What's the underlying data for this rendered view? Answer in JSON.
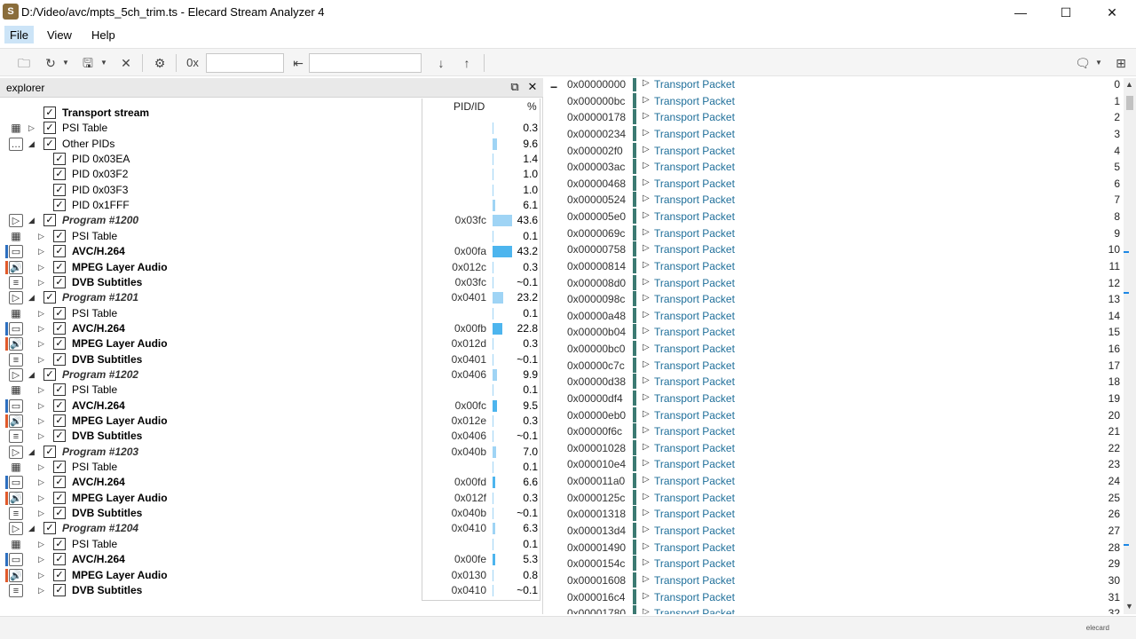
{
  "window": {
    "title": "D:/Video/avc/mpts_5ch_trim.ts - Elecard Stream Analyzer 4",
    "app_icon": "S",
    "minimize": "—",
    "maximize": "☐",
    "close": "✕"
  },
  "menu": {
    "file": "File",
    "view": "View",
    "help": "Help"
  },
  "toolbar": {
    "hex_prefix": "0x",
    "hex_value": "",
    "search_value": ""
  },
  "explorer": {
    "title": "explorer",
    "col_pid": "PID/ID",
    "col_pct": "%",
    "rows": [
      {
        "label": "Transport stream",
        "pid": "",
        "pct": "",
        "style": "bold"
      },
      {
        "label": "PSI Table",
        "pid": "",
        "pct": "0.3",
        "style": "normal"
      },
      {
        "label": "Other PIDs",
        "pid": "",
        "pct": "9.6",
        "style": "normal"
      },
      {
        "label": "PID 0x03EA",
        "pid": "",
        "pct": "1.4",
        "style": "normal"
      },
      {
        "label": "PID 0x03F2",
        "pid": "",
        "pct": "1.0",
        "style": "normal"
      },
      {
        "label": "PID 0x03F3",
        "pid": "",
        "pct": "1.0",
        "style": "normal"
      },
      {
        "label": "PID 0x1FFF",
        "pid": "",
        "pct": "6.1",
        "style": "normal"
      },
      {
        "label": "Program #1200",
        "pid": "0x03fc",
        "pct": "43.6",
        "style": "italic"
      },
      {
        "label": "PSI Table",
        "pid": "",
        "pct": "0.1",
        "style": "normal"
      },
      {
        "label": "AVC/H.264",
        "pid": "0x00fa",
        "pct": "43.2",
        "style": "bold"
      },
      {
        "label": "MPEG Layer Audio",
        "pid": "0x012c",
        "pct": "0.3",
        "style": "bold"
      },
      {
        "label": "DVB Subtitles",
        "pid": "0x03fc",
        "pct": "~0.1",
        "style": "bold"
      },
      {
        "label": "Program #1201",
        "pid": "0x0401",
        "pct": "23.2",
        "style": "italic"
      },
      {
        "label": "PSI Table",
        "pid": "",
        "pct": "0.1",
        "style": "normal"
      },
      {
        "label": "AVC/H.264",
        "pid": "0x00fb",
        "pct": "22.8",
        "style": "bold"
      },
      {
        "label": "MPEG Layer Audio",
        "pid": "0x012d",
        "pct": "0.3",
        "style": "bold"
      },
      {
        "label": "DVB Subtitles",
        "pid": "0x0401",
        "pct": "~0.1",
        "style": "bold"
      },
      {
        "label": "Program #1202",
        "pid": "0x0406",
        "pct": "9.9",
        "style": "italic"
      },
      {
        "label": "PSI Table",
        "pid": "",
        "pct": "0.1",
        "style": "normal"
      },
      {
        "label": "AVC/H.264",
        "pid": "0x00fc",
        "pct": "9.5",
        "style": "bold"
      },
      {
        "label": "MPEG Layer Audio",
        "pid": "0x012e",
        "pct": "0.3",
        "style": "bold"
      },
      {
        "label": "DVB Subtitles",
        "pid": "0x0406",
        "pct": "~0.1",
        "style": "bold"
      },
      {
        "label": "Program #1203",
        "pid": "0x040b",
        "pct": "7.0",
        "style": "italic"
      },
      {
        "label": "PSI Table",
        "pid": "",
        "pct": "0.1",
        "style": "normal"
      },
      {
        "label": "AVC/H.264",
        "pid": "0x00fd",
        "pct": "6.6",
        "style": "bold"
      },
      {
        "label": "MPEG Layer Audio",
        "pid": "0x012f",
        "pct": "0.3",
        "style": "bold"
      },
      {
        "label": "DVB Subtitles",
        "pid": "0x040b",
        "pct": "~0.1",
        "style": "bold"
      },
      {
        "label": "Program #1204",
        "pid": "0x0410",
        "pct": "6.3",
        "style": "italic"
      },
      {
        "label": "PSI Table",
        "pid": "",
        "pct": "0.1",
        "style": "normal"
      },
      {
        "label": "AVC/H.264",
        "pid": "0x00fe",
        "pct": "5.3",
        "style": "bold"
      },
      {
        "label": "MPEG Layer Audio",
        "pid": "0x0130",
        "pct": "0.8",
        "style": "bold"
      },
      {
        "label": "DVB Subtitles",
        "pid": "0x0410",
        "pct": "~0.1",
        "style": "bold"
      }
    ]
  },
  "packets": {
    "name": "Transport Packet",
    "rows": [
      {
        "addr": "0x00000000",
        "n": "0"
      },
      {
        "addr": "0x000000bc",
        "n": "1"
      },
      {
        "addr": "0x00000178",
        "n": "2"
      },
      {
        "addr": "0x00000234",
        "n": "3"
      },
      {
        "addr": "0x000002f0",
        "n": "4"
      },
      {
        "addr": "0x000003ac",
        "n": "5"
      },
      {
        "addr": "0x00000468",
        "n": "6"
      },
      {
        "addr": "0x00000524",
        "n": "7"
      },
      {
        "addr": "0x000005e0",
        "n": "8"
      },
      {
        "addr": "0x0000069c",
        "n": "9"
      },
      {
        "addr": "0x00000758",
        "n": "10"
      },
      {
        "addr": "0x00000814",
        "n": "11"
      },
      {
        "addr": "0x000008d0",
        "n": "12"
      },
      {
        "addr": "0x0000098c",
        "n": "13"
      },
      {
        "addr": "0x00000a48",
        "n": "14"
      },
      {
        "addr": "0x00000b04",
        "n": "15"
      },
      {
        "addr": "0x00000bc0",
        "n": "16"
      },
      {
        "addr": "0x00000c7c",
        "n": "17"
      },
      {
        "addr": "0x00000d38",
        "n": "18"
      },
      {
        "addr": "0x00000df4",
        "n": "19"
      },
      {
        "addr": "0x00000eb0",
        "n": "20"
      },
      {
        "addr": "0x00000f6c",
        "n": "21"
      },
      {
        "addr": "0x00001028",
        "n": "22"
      },
      {
        "addr": "0x000010e4",
        "n": "23"
      },
      {
        "addr": "0x000011a0",
        "n": "24"
      },
      {
        "addr": "0x0000125c",
        "n": "25"
      },
      {
        "addr": "0x00001318",
        "n": "26"
      },
      {
        "addr": "0x000013d4",
        "n": "27"
      },
      {
        "addr": "0x00001490",
        "n": "28"
      },
      {
        "addr": "0x0000154c",
        "n": "29"
      },
      {
        "addr": "0x00001608",
        "n": "30"
      },
      {
        "addr": "0x000016c4",
        "n": "31"
      },
      {
        "addr": "0x00001780",
        "n": "32"
      }
    ]
  },
  "status": {
    "brand": "elecard"
  },
  "colors": {
    "accent": "#3c7a72",
    "link": "#1f6f9a",
    "bar": "#9fd4f5",
    "bar_strong": "#4db5ee"
  }
}
